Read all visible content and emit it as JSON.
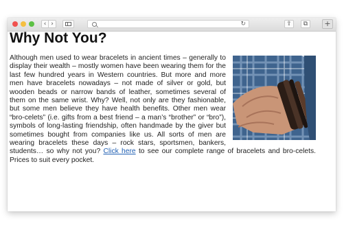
{
  "browser": {
    "back_glyph": "‹",
    "forward_glyph": "›",
    "reload_glyph": "↻",
    "share_glyph": "⇪",
    "tabs_glyph": "⧉",
    "new_tab_glyph": "+",
    "icons": [
      "close-dot",
      "minimize-dot",
      "zoom-dot",
      "back-icon",
      "forward-icon",
      "sidebar-icon",
      "search-icon",
      "reload-icon",
      "share-icon",
      "tabs-icon",
      "plus-icon"
    ],
    "colors": {
      "close": "#f0524f",
      "minimize": "#f5bf41",
      "zoom": "#5dc145"
    }
  },
  "article": {
    "title": "Why Not You?",
    "body_before_link": "Although men used to wear bracelets in ancient times – generally to display their wealth – mostly women have been wearing them for the last few hundred years in Western countries. But more and more men have bracelets nowadays – not made of silver or gold, but wooden beads or narrow bands of leather, sometimes several of them on the same wrist. Why? Well, not only are they fashionable, but some men believe they have health benefits. Other men wear “bro-celets” (i.e. gifts from a best friend – a man’s “brother” or “bro”), symbols of long-lasting friendship, often handmade by the giver but sometimes bought from companies like us. All sorts of men are wearing bracelets these days – rock stars, sportsmen, bankers, students… so why not you?",
    "link_text": "Click here",
    "body_after_link": "to see our complete range of bracelets and bro-celets. Prices to suit every pocket.",
    "link_color": "#1f5fb3"
  }
}
